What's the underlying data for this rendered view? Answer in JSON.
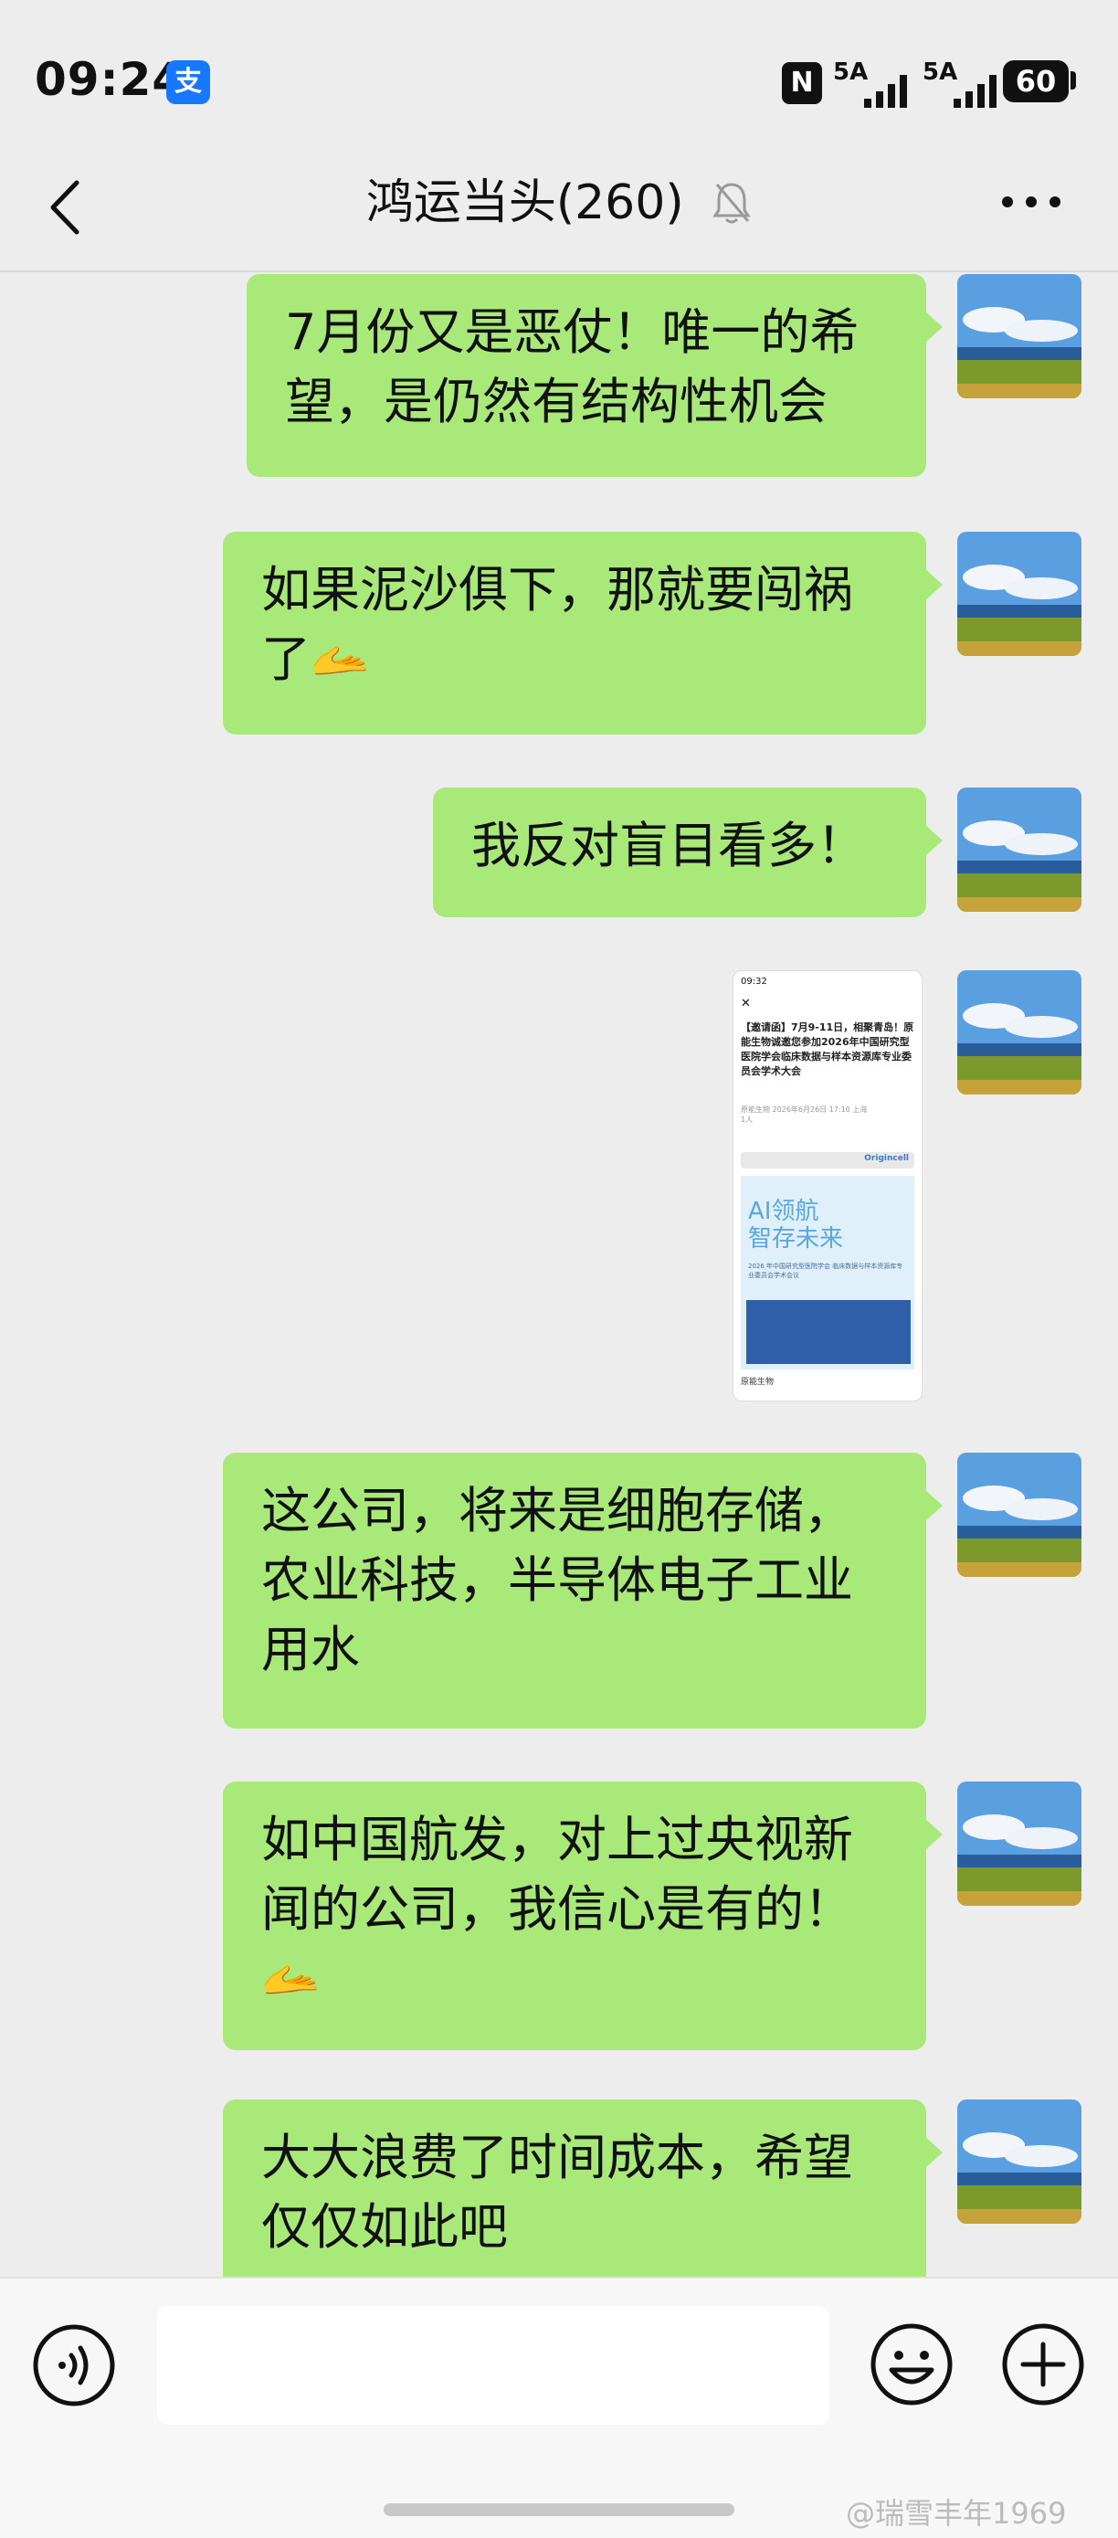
{
  "status": {
    "time": "09:24",
    "alipay_glyph": "支",
    "nfc_glyph": "N",
    "sim1": "5A",
    "sim2": "5A",
    "battery": "60"
  },
  "header": {
    "title": "鸿运当头(260)",
    "icons": {
      "back": "chevron-left-icon",
      "mute": "bell-off-icon",
      "more": "more-dots-icon"
    }
  },
  "messages": [
    {
      "type": "text",
      "lines": [
        "7月份又是恶仗！唯一的希",
        "望，是仍然有结构性机会"
      ]
    },
    {
      "type": "text",
      "lines": [
        "如果泥沙俱下，那就要闯祸",
        "了"
      ],
      "emoji": "🫴"
    },
    {
      "type": "text",
      "lines": [
        "我反对盲目看多！"
      ]
    },
    {
      "type": "image",
      "shot": {
        "time": "09:32",
        "title": "【邀请函】7月9-11日，相聚青岛！原能生物诚邀您参加2026年中国研究型医院学会临床数据与样本资源库专业委员会学术大会",
        "meta": "原能生物  2026年6月26日 17:10  上海",
        "reads": "1人",
        "brand": "Origincell",
        "headline1": "AI领航",
        "headline2": "智存未来",
        "subtitle": "2026 年中国研究型医院学会 临床数据与样本资源库专业委员会学术会议",
        "footer": "原能生物"
      }
    },
    {
      "type": "text",
      "lines": [
        "这公司，将来是细胞存储，",
        "农业科技，半导体电子工业",
        "用水"
      ]
    },
    {
      "type": "text",
      "lines": [
        "如中国航发，对上过央视新",
        "闻的公司，我信心是有的！"
      ],
      "emoji": "🫴"
    },
    {
      "type": "text",
      "lines": [
        "大大浪费了时间成本，希望",
        "仅仅如此吧"
      ]
    }
  ],
  "input": {
    "value": "",
    "placeholder": ""
  },
  "toolbar_icons": {
    "voice": "voice-icon",
    "emoji": "smiley-icon",
    "plus": "plus-icon"
  },
  "watermark": "@瑞雪丰年1969",
  "colors": {
    "bubble": "#a9e97a",
    "background": "#ededed",
    "alipay": "#1677ff"
  }
}
